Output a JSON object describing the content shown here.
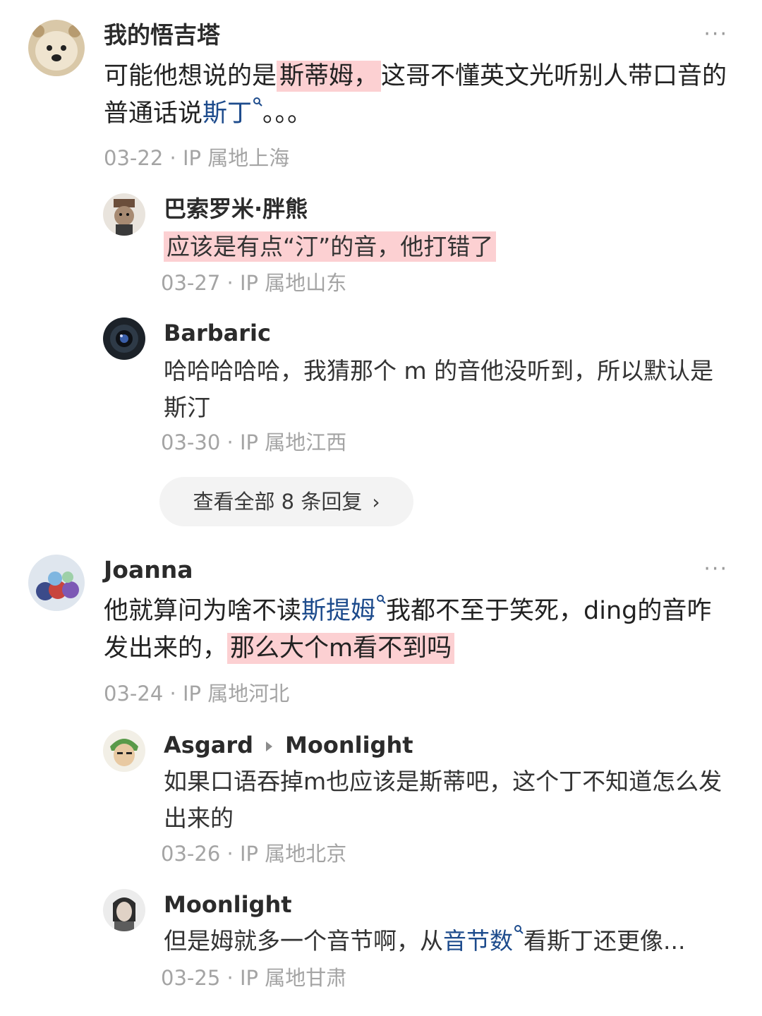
{
  "comments": [
    {
      "user": "我的悟吉塔",
      "text_pre": "可能他想说的是",
      "text_hl": "斯蒂姆，",
      "text_mid": "这哥不懂英文光听别人带口音的普通话说",
      "text_link": "斯丁",
      "text_post": "。。。",
      "date": "03-22",
      "location": "IP 属地上海",
      "more": "···"
    },
    {
      "user": "Joanna",
      "text_pre": "他就算问为啥不读",
      "text_link": "斯提姆",
      "text_mid": "我都不至于笑死，ding的音咋发出来的，",
      "text_hl": "那么大个m看不到吗",
      "date": "03-24",
      "location": "IP 属地河北",
      "more": "···"
    }
  ],
  "replies": [
    {
      "user": "巴索罗米·胖熊",
      "text_hl": "应该是有点“汀”的音，他打错了",
      "date": "03-27",
      "location": "IP 属地山东"
    },
    {
      "user": "Barbaric",
      "text": "哈哈哈哈哈，我猜那个 m 的音他没听到，所以默认是 斯汀",
      "date": "03-30",
      "location": "IP 属地江西"
    },
    {
      "user": "Asgard",
      "reply_to": "Moonlight",
      "text": "如果口语吞掉m也应该是斯蒂吧，这个丁不知道怎么发出来的",
      "date": "03-26",
      "location": "IP 属地北京"
    },
    {
      "user": "Moonlight",
      "text_pre": "但是姆就多一个音节啊，从",
      "text_link": "音节数",
      "text_post": "看斯丁还更像...",
      "date": "03-25",
      "location": "IP 属地甘肃"
    }
  ],
  "view_all": "查看全部 8 条回复",
  "meta_sep": " · ",
  "colors": {
    "highlight": "#fcd0d2",
    "link": "#1d4b8c",
    "meta": "#a4a4a4"
  },
  "icons": [
    "more-icon",
    "search-icon",
    "chevron-right-icon",
    "reply-arrow-icon"
  ]
}
